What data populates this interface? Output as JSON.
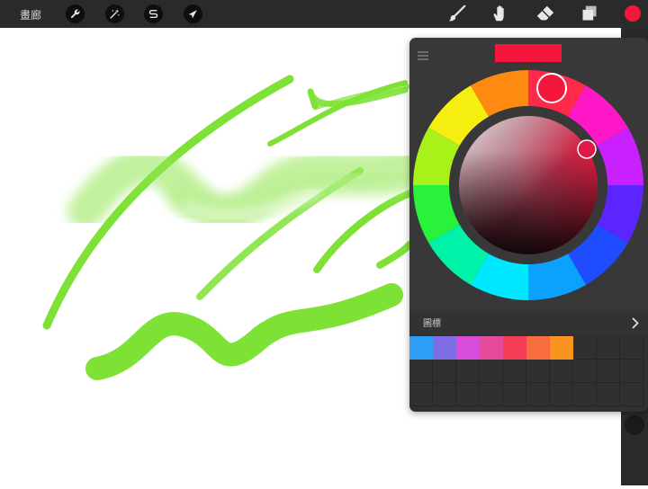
{
  "app": {
    "gallery_label": "畫廊",
    "current_color": "#f5163c"
  },
  "palette": {
    "title": "圖標",
    "swatches": [
      "#2d9df5",
      "#7f6de6",
      "#d74cd9",
      "#e54a9b",
      "#f53c55",
      "#f76d3e",
      "#f8941f"
    ]
  },
  "colors": {
    "toolbar_bg": "#2a2a2a",
    "panel_bg": "#383838",
    "stroke_green": "#7ee236"
  }
}
